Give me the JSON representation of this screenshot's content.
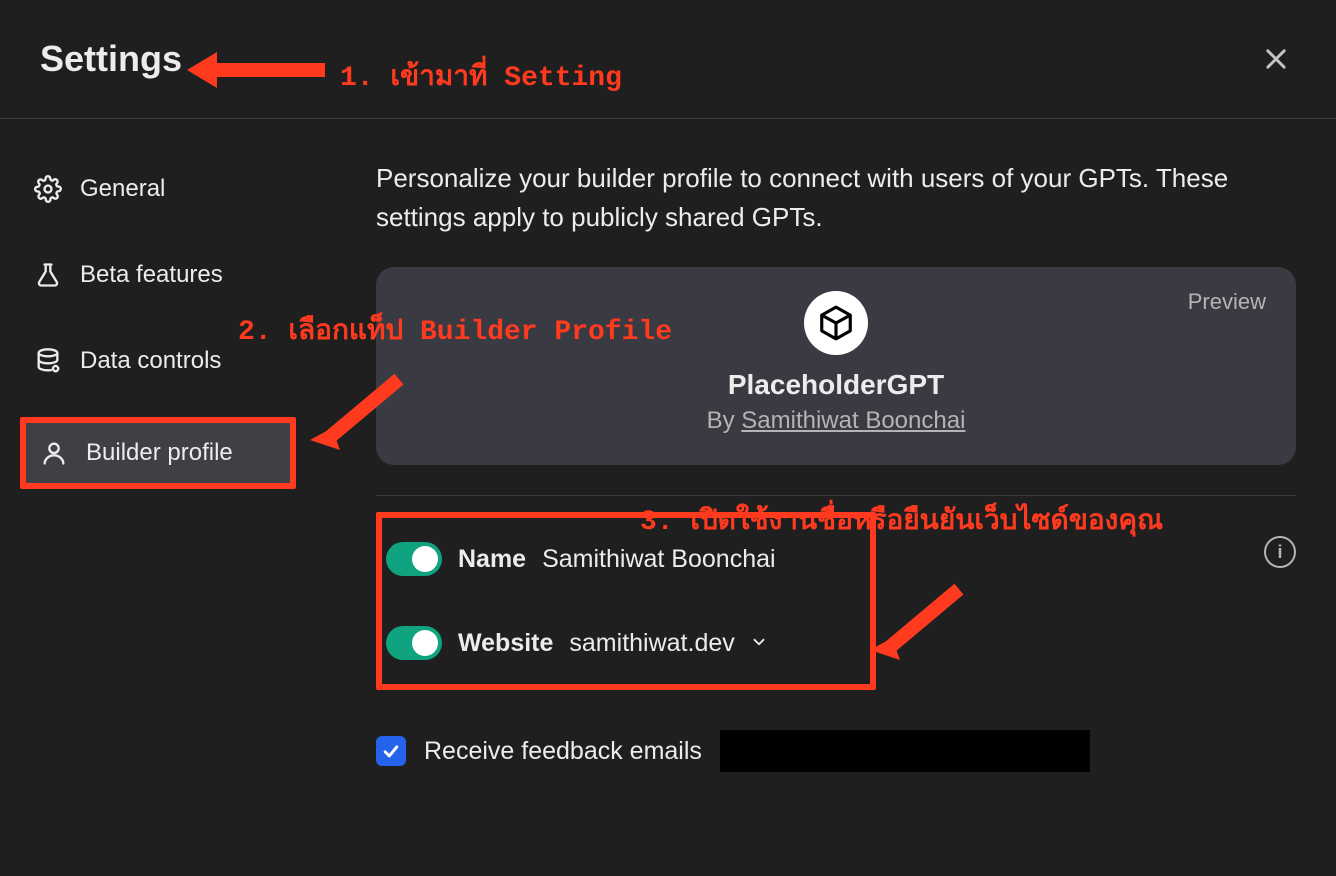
{
  "header": {
    "title": "Settings"
  },
  "sidebar": {
    "items": [
      {
        "label": "General"
      },
      {
        "label": "Beta features"
      },
      {
        "label": "Data controls"
      },
      {
        "label": "Builder profile"
      }
    ]
  },
  "content": {
    "description": "Personalize your builder profile to connect with users of your GPTs. These settings apply to publicly shared GPTs.",
    "preview": {
      "badge": "Preview",
      "gpt_name": "PlaceholderGPT",
      "by_prefix": "By ",
      "author": "Samithiwat Boonchai"
    },
    "toggles": {
      "name": {
        "label": "Name",
        "value": "Samithiwat Boonchai",
        "on": true
      },
      "website": {
        "label": "Website",
        "value": "samithiwat.dev",
        "on": true
      }
    },
    "feedback": {
      "label": "Receive feedback emails",
      "checked": true
    }
  },
  "annotations": {
    "step1": "1. เข้ามาที่ Setting",
    "step2": "2. เลือกแท็ป Builder Profile",
    "step3": "3. เปิดใช้งานชื่อหรือยืนยันเว็บไซด์ของคุณ"
  }
}
